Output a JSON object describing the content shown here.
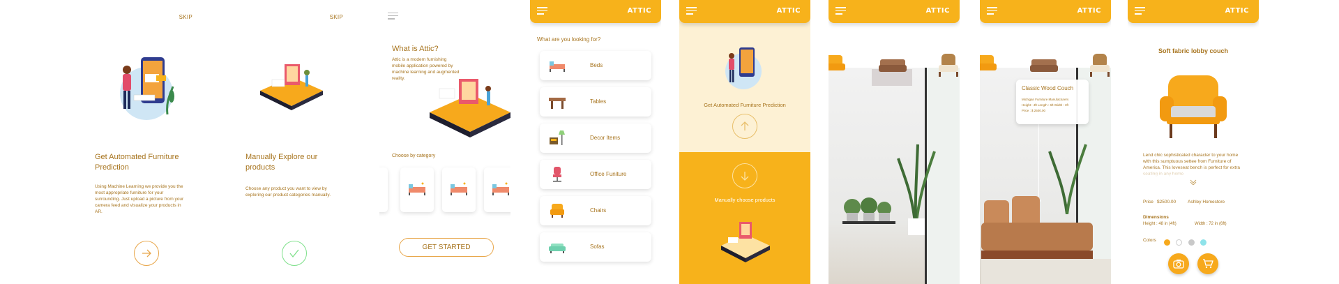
{
  "onboarding1": {
    "skip": "SKIP",
    "title": "Get Automated Furniture Prediction",
    "text": "Using Machine Learning we provide you the most appropriate furniture for your surrounding. Just upload a picture from your camera feed and visualize your products in AR."
  },
  "onboarding2": {
    "skip": "SKIP",
    "title": "Manually Explore our products",
    "text": "Choose any product you want to view by exploring our product categories manually."
  },
  "about": {
    "title": "What is Attic?",
    "text": "Attic is a modern furnishing mobile application powered by machine learning and augmented reality.",
    "category_label": "Choose by category",
    "get_started": "GET STARTED"
  },
  "app": {
    "logo": "ATTIC"
  },
  "categories": {
    "prompt": "What are you looking for?",
    "items": [
      {
        "label": "Beds",
        "icon": "bed-icon"
      },
      {
        "label": "Tables",
        "icon": "table-icon"
      },
      {
        "label": "Decor Items",
        "icon": "lamp-icon"
      },
      {
        "label": "Office Funiture",
        "icon": "office-chair-icon"
      },
      {
        "label": "Chairs",
        "icon": "armchair-icon"
      },
      {
        "label": "Sofas",
        "icon": "sofa-icon"
      }
    ]
  },
  "choice": {
    "auto_label": "Get Automated Furniture Prediction",
    "manual_label": "Manually choose products"
  },
  "ar": {
    "card_title": "Classic Wood Couch",
    "card_line1": "Michigan Furniture Manufacturers",
    "card_line2": "Height : 4ft   Length : 6ft   Width : 3ft",
    "card_line3": "Price : $ 2500.00"
  },
  "product": {
    "title": "Soft fabric lobby couch",
    "description": "Lend chic sophisticated character to your home with this sumptuous settee from Furniture of America. This loveseat bench is perfect for extra seating in any home",
    "price_label": "Price",
    "price": "$2500.00",
    "brand": "Ashley Homestore",
    "dimensions_label": "Dimensions",
    "height": "Height : 48 in (4ft)",
    "width": "Width : 72 in (6ft)",
    "colors_label": "Colors",
    "colors": [
      "#f7a91c",
      "#ffffff",
      "#c9c9c9",
      "#8fe3ea"
    ]
  },
  "colors": {
    "accent": "#f7b21b",
    "text": "#a7741e",
    "light_bg": "#fdf1d4"
  }
}
